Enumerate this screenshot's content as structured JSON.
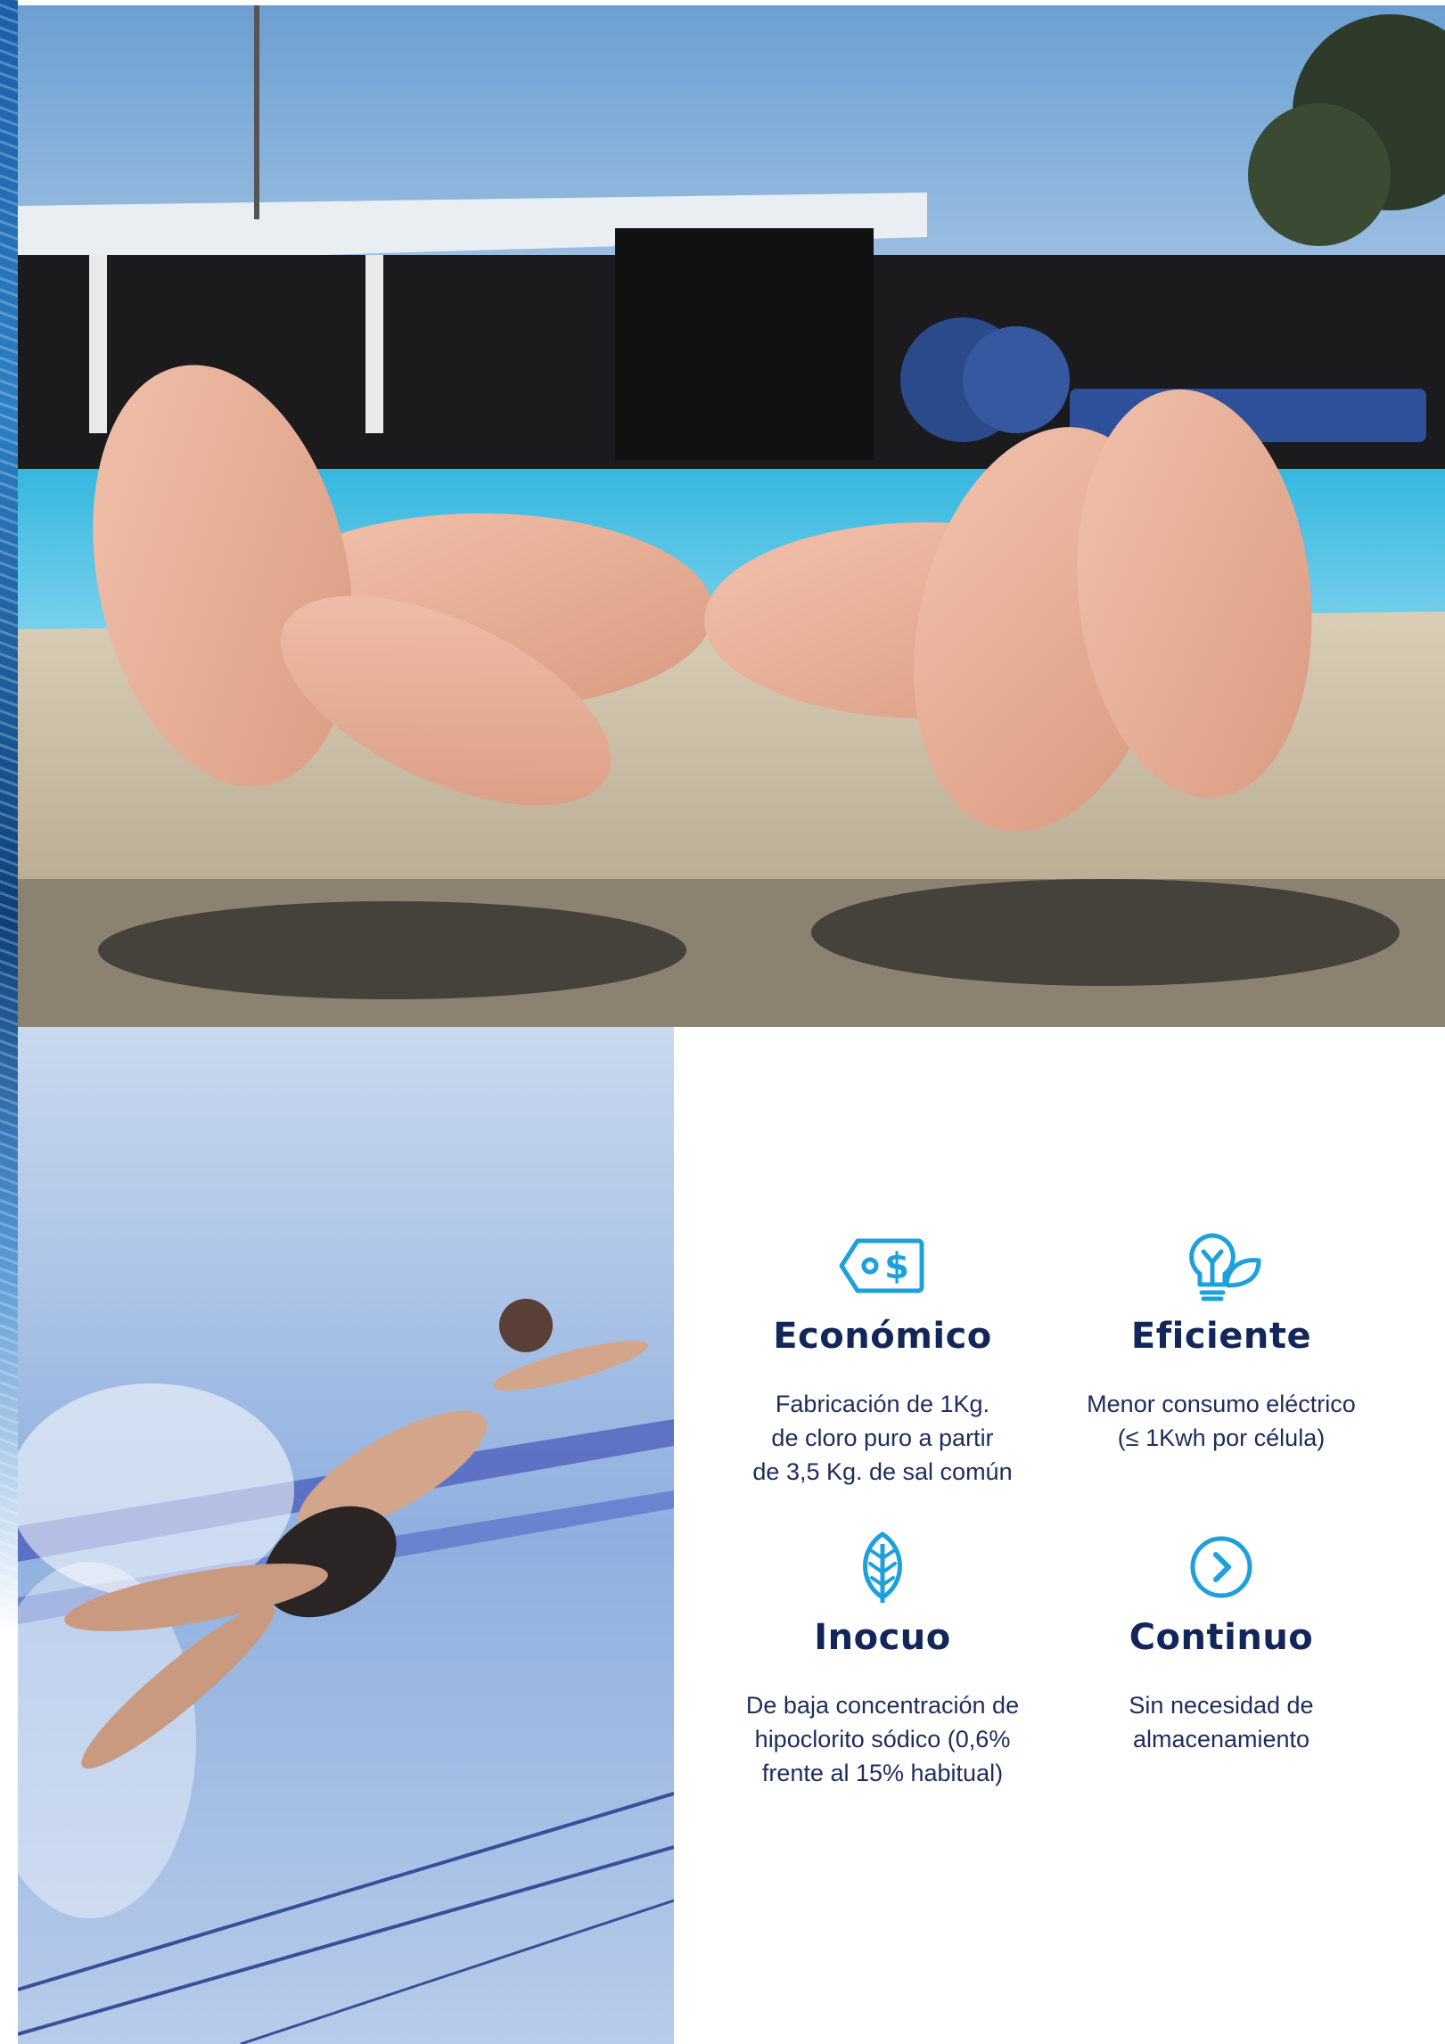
{
  "features": [
    {
      "icon": "price-tag-dollar-icon",
      "title": "Económico",
      "text": "Fabricación de 1Kg.\nde cloro puro a partir\nde 3,5 Kg. de sal común"
    },
    {
      "icon": "lightbulb-leaf-icon",
      "title": "Eficiente",
      "text": "Menor consumo eléctrico\n(≤ 1Kwh por célula)"
    },
    {
      "icon": "leaf-icon",
      "title": "Inocuo",
      "text": "De baja concentración de\nhipoclorito sódico (0,6%\nfrente al 15% habitual)"
    },
    {
      "icon": "chevron-right-circle-icon",
      "title": "Continuo",
      "text": "Sin necesidad de\nalmacenamiento"
    }
  ],
  "colors": {
    "icon": "#1ea0dc",
    "heading": "#13265a",
    "body": "#1d2c5c"
  }
}
